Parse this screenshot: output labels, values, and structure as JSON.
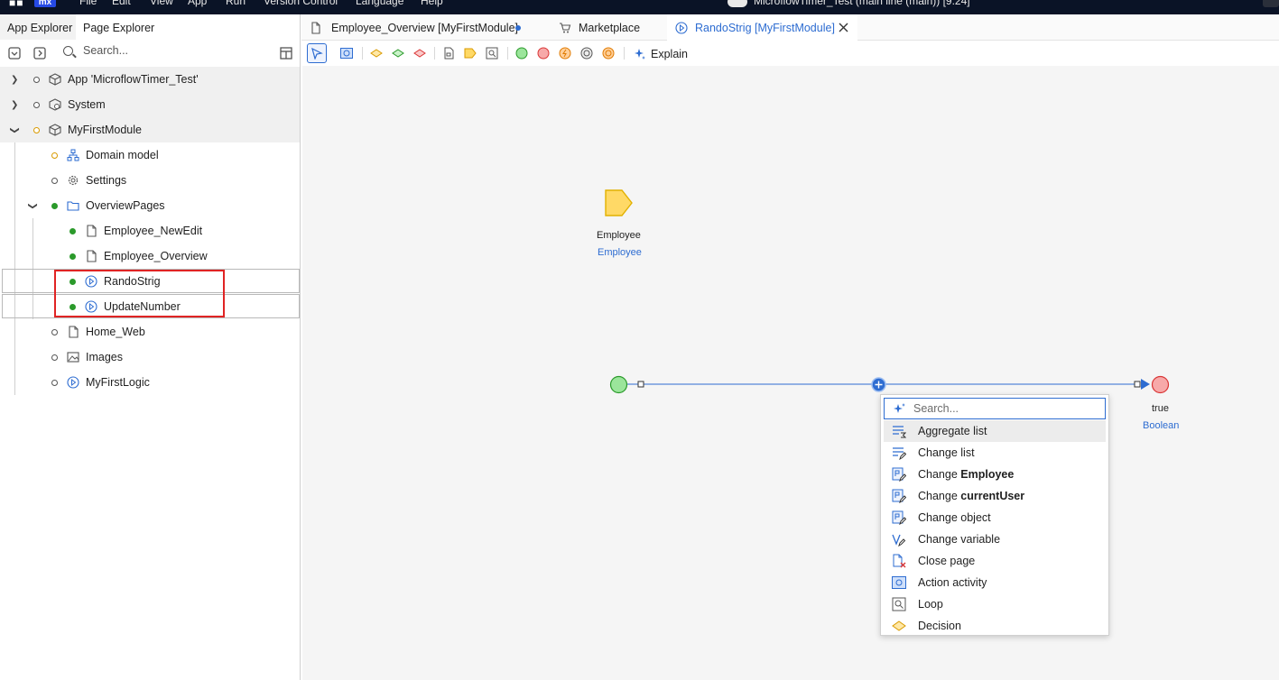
{
  "menubar": {
    "logo": "mx",
    "items": [
      "File",
      "Edit",
      "View",
      "App",
      "Run",
      "Version Control",
      "Language",
      "Help"
    ],
    "window_title": "MicroflowTimer_Test (main line (main)) [9.24]"
  },
  "explorer": {
    "tabs": [
      "App Explorer",
      "Page Explorer"
    ],
    "search_placeholder": "Search...",
    "tree": [
      {
        "label": "App 'MicroflowTimer_Test'"
      },
      {
        "label": "System"
      },
      {
        "label": "MyFirstModule"
      },
      {
        "label": "Domain model"
      },
      {
        "label": "Settings"
      },
      {
        "label": "OverviewPages"
      },
      {
        "label": "Employee_NewEdit"
      },
      {
        "label": "Employee_Overview"
      },
      {
        "label": "RandoStrig"
      },
      {
        "label": "UpdateNumber"
      },
      {
        "label": "Home_Web"
      },
      {
        "label": "Images"
      },
      {
        "label": "MyFirstLogic"
      }
    ]
  },
  "doc_tabs": [
    {
      "label": "Employee_Overview [MyFirstModule]",
      "modified": true
    },
    {
      "label": "Marketplace"
    },
    {
      "label": "RandoStrig [MyFirstModule]",
      "active": true
    }
  ],
  "toolbar": {
    "explain_label": "Explain"
  },
  "canvas": {
    "parameter": {
      "name": "Employee",
      "type": "Employee"
    },
    "end_event": {
      "value": "true",
      "type": "Boolean"
    },
    "colors": {
      "start": "#9be59b",
      "end": "#f7a9a9",
      "flow": "#2d6cd1",
      "parameter": "#ffd966"
    }
  },
  "popup": {
    "search_placeholder": "Search...",
    "items": [
      {
        "label": "Aggregate list",
        "icon": "aggregate-list-icon"
      },
      {
        "label": "Change list",
        "icon": "change-list-icon"
      },
      {
        "label_prefix": "Change ",
        "label_bold": "Employee",
        "icon": "change-object-icon"
      },
      {
        "label_prefix": "Change ",
        "label_bold": "currentUser",
        "icon": "change-object-icon"
      },
      {
        "label": "Change object",
        "icon": "change-object-icon"
      },
      {
        "label": "Change variable",
        "icon": "change-variable-icon"
      },
      {
        "label": "Close page",
        "icon": "close-page-icon"
      },
      {
        "label": "Action activity",
        "icon": "action-activity-icon"
      },
      {
        "label": "Loop",
        "icon": "loop-icon"
      },
      {
        "label": "Decision",
        "icon": "decision-icon"
      }
    ]
  }
}
